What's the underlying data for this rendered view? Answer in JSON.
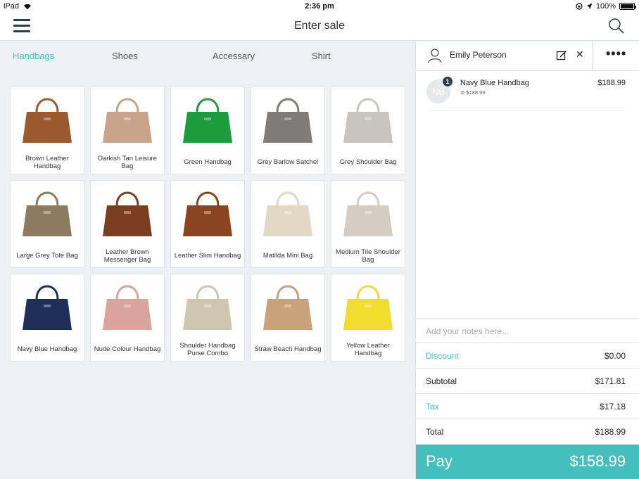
{
  "status_bar": {
    "device": "iPad",
    "time": "2:36 pm",
    "battery": "100%"
  },
  "navbar": {
    "title": "Enter sale"
  },
  "tabs": [
    {
      "label": "Handbags",
      "active": true
    },
    {
      "label": "Shoes",
      "active": false
    },
    {
      "label": "Accessary",
      "active": false
    },
    {
      "label": "Shirt",
      "active": false
    }
  ],
  "products": [
    {
      "name": "Brown Leather Handbag",
      "color": "#9b5a2e"
    },
    {
      "name": "Darkish Tan Leisure Bag",
      "color": "#c9a48a"
    },
    {
      "name": "Green Handbag",
      "color": "#1e9b3c"
    },
    {
      "name": "Grey Barlow Satchel",
      "color": "#7f7b78"
    },
    {
      "name": "Grey Shoulder Bag",
      "color": "#c9c4be"
    },
    {
      "name": "Large Grey Tote Bag",
      "color": "#8d7a5f"
    },
    {
      "name": "Leather Brown Messenger Bag",
      "color": "#7a3f20"
    },
    {
      "name": "Leather Slim Handbag",
      "color": "#8b4420"
    },
    {
      "name": "Matilda Mini Bag",
      "color": "#e3d8c3"
    },
    {
      "name": "Medium Tile Shoulder Bag",
      "color": "#d5cdc2"
    },
    {
      "name": "Navy Blue Handbag",
      "color": "#1f2f5a"
    },
    {
      "name": "Nude Colour Handbag",
      "color": "#dba49a"
    },
    {
      "name": "Shoulder Handbag Purse Combo",
      "color": "#cfc6b0"
    },
    {
      "name": "Straw Beach Handbag",
      "color": "#c9a17a"
    },
    {
      "name": "Yellow Leather Handbag",
      "color": "#f2dc2d"
    }
  ],
  "cart": {
    "customer": "Emily Peterson",
    "items": [
      {
        "initials": "NB",
        "qty": "1",
        "name": "Navy Blue Handbag",
        "sub": "$188.99",
        "price": "$188.99"
      }
    ],
    "notes_placeholder": "Add your notes here...",
    "discount_label": "Discount",
    "discount": "$0.00",
    "subtotal_label": "Subtotal",
    "subtotal": "$171.81",
    "tax_label": "Tax",
    "tax": "$17.18",
    "total_label": "Total",
    "total": "$188.99",
    "pay_label": "Pay",
    "pay_amount": "$158.99"
  },
  "colors": {
    "accent": "#4bbfc0",
    "pay": "#45bfbd",
    "dark": "#2c3e50"
  }
}
